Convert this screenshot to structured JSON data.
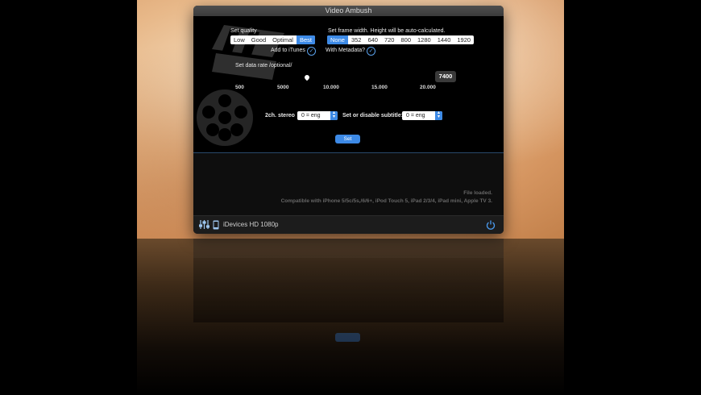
{
  "window": {
    "title": "Video Ambush"
  },
  "quality": {
    "label": "Set quality",
    "options": [
      "Low",
      "Good",
      "Optimal",
      "Best"
    ],
    "selected": "Best"
  },
  "frame_width": {
    "label": "Set frame width. Height will be auto-calculated.",
    "options": [
      "None",
      "352",
      "640",
      "720",
      "800",
      "1280",
      "1440",
      "1920"
    ],
    "selected": "None"
  },
  "itunes": {
    "label": "Add to iTunes"
  },
  "metadata": {
    "label": "With Metadata?"
  },
  "data_rate": {
    "label": "Set data rate /optional/",
    "ticks": [
      "500",
      "5000",
      "10.000",
      "15.000",
      "20.000"
    ],
    "value": "7400"
  },
  "audio": {
    "label": "2ch. stereo",
    "value": "0 = eng"
  },
  "subtitle": {
    "label": "Set or disable subtitle:",
    "value": "0 = eng"
  },
  "set_button": {
    "label": "Set"
  },
  "status": {
    "line1": "File loaded.",
    "line2": "Compatible with iPhone 5/5c/5s,/6/6+, iPod Touch 5, iPad 2/3/4, iPad mini, Apple TV 3."
  },
  "bottom": {
    "preset": "iDevices HD 1080p"
  },
  "icons": [
    "mixer-icon",
    "device-icon",
    "power-icon",
    "checkmark-icon",
    "film-reel-icon",
    "clapperboard-icon"
  ],
  "colors": {
    "accent": "#3d8ae6",
    "window_bg": "#000000",
    "titlebar": "#454545"
  }
}
